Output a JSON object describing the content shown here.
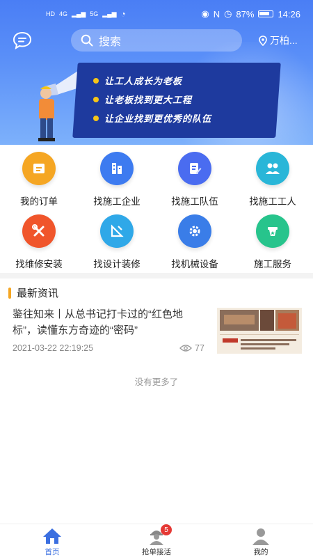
{
  "status_bar": {
    "network_left": "HD",
    "signal_1": "4G",
    "signal_2": "5G",
    "battery_percent": "87%",
    "time": "14:26"
  },
  "header": {
    "search_placeholder": "搜索",
    "location": "万柏..."
  },
  "banner": {
    "slogans": [
      "让工人成长为老板",
      "让老板找到更大工程",
      "让企业找到更优秀的队伍"
    ]
  },
  "services": [
    {
      "label": "我的订单",
      "icon": "order-icon",
      "color": "#f5a623"
    },
    {
      "label": "找施工企业",
      "icon": "building-icon",
      "color": "#3d7bf0"
    },
    {
      "label": "找施工队伍",
      "icon": "edit-doc-icon",
      "color": "#4a6cf0"
    },
    {
      "label": "找施工工人",
      "icon": "workers-icon",
      "color": "#29b6d8"
    },
    {
      "label": "找维修安装",
      "icon": "tools-icon",
      "color": "#f0552b"
    },
    {
      "label": "找设计装修",
      "icon": "design-icon",
      "color": "#2fa8e8"
    },
    {
      "label": "找机械设备",
      "icon": "gear-icon",
      "color": "#3a7de8"
    },
    {
      "label": "施工服务",
      "icon": "service-icon",
      "color": "#27c48c"
    }
  ],
  "news": {
    "section_title": "最新资讯",
    "items": [
      {
        "title": "鉴往知来丨从总书记打卡过的“红色地标”，读懂东方奇迹的“密码”",
        "time": "2021-03-22 22:19:25",
        "views": "77"
      }
    ],
    "no_more": "没有更多了"
  },
  "tabbar": {
    "tabs": [
      {
        "label": "首页",
        "icon": "home-icon"
      },
      {
        "label": "抢单接活",
        "icon": "worker-icon",
        "badge": "5"
      },
      {
        "label": "我的",
        "icon": "user-icon"
      }
    ],
    "active_color": "#3b6fe0"
  }
}
